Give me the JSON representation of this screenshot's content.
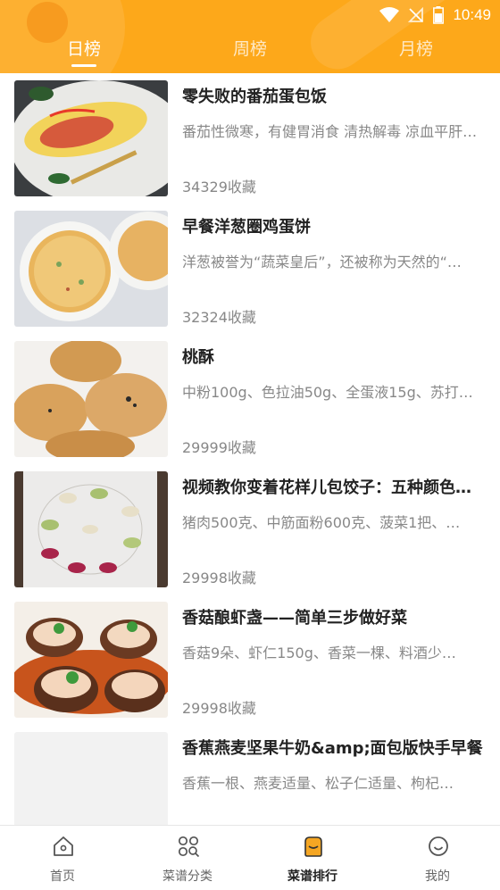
{
  "status_bar": {
    "time": "10:49"
  },
  "tabs": [
    {
      "label": "日榜"
    },
    {
      "label": "周榜"
    },
    {
      "label": "月榜"
    }
  ],
  "recipes": [
    {
      "title": "零失败的番茄蛋包饭",
      "desc": "番茄性微寒，有健胃消食 清热解毒 凉血平肝…",
      "favorites": "34329收藏"
    },
    {
      "title": "早餐洋葱圈鸡蛋饼",
      "desc": "洋葱被誉为“蔬菜皇后”，还被称为天然的“…",
      "favorites": "32324收藏"
    },
    {
      "title": "桃酥",
      "desc": "中粉100g、色拉油50g、全蛋液15g、苏打粉…",
      "favorites": "29999收藏"
    },
    {
      "title": "视频教你变着花样儿包饺子：五种颜色饺子…",
      "desc": "猪肉500克、中筋面粉600克、菠菜1把、…",
      "favorites": "29998收藏"
    },
    {
      "title": "香菇酿虾盏——简单三步做好菜",
      "desc": "香菇9朵、虾仁150g、香菜一棵、料酒少…",
      "favorites": "29998收藏"
    },
    {
      "title": "香蕉燕麦坚果牛奶&amp;面包版快手早餐",
      "desc": "香蕉一根、燕麦适量、松子仁适量、枸杞…",
      "favorites": ""
    }
  ],
  "bottom_nav": [
    {
      "label": "首页",
      "icon": "home-icon"
    },
    {
      "label": "菜谱分类",
      "icon": "category-icon"
    },
    {
      "label": "菜谱排行",
      "icon": "ranking-icon"
    },
    {
      "label": "我的",
      "icon": "profile-icon"
    }
  ],
  "colors": {
    "accent": "#fda81a",
    "ranking_icon": "#f5a623"
  }
}
